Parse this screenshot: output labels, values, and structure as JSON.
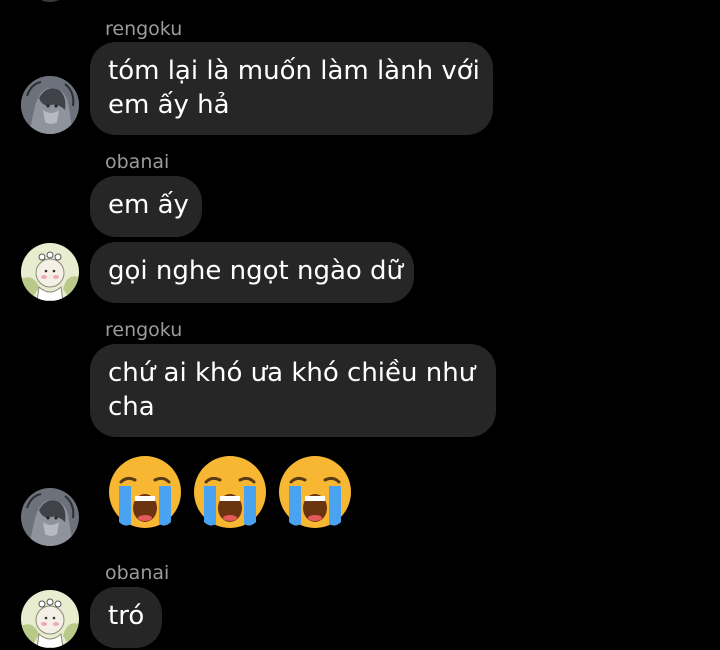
{
  "messages": [
    {
      "sender": "rengoku",
      "lines": [
        "tóm lại là muốn làm lành với",
        "em ấy hả"
      ],
      "avatar": "rengoku-avatar"
    },
    {
      "sender": "obanai",
      "lines": [
        "em ấy"
      ]
    },
    {
      "lines": [
        "gọi nghe ngọt ngào dữ"
      ],
      "avatar": "obanai-avatar"
    },
    {
      "sender": "rengoku",
      "lines": [
        "chứ ai khó ưa khó chiều như",
        "cha"
      ]
    },
    {
      "emojis": [
        "loudly-crying-face",
        "loudly-crying-face",
        "loudly-crying-face"
      ],
      "avatar": "rengoku-avatar"
    },
    {
      "sender": "obanai",
      "lines": [
        "tró"
      ],
      "avatar": "obanai-avatar"
    }
  ],
  "colors": {
    "background": "#000000",
    "bubble": "#262626",
    "sender_name": "#9b9b9b",
    "text": "#ffffff",
    "emoji_face": "#f7b733",
    "emoji_tears": "#4aa3f0"
  }
}
